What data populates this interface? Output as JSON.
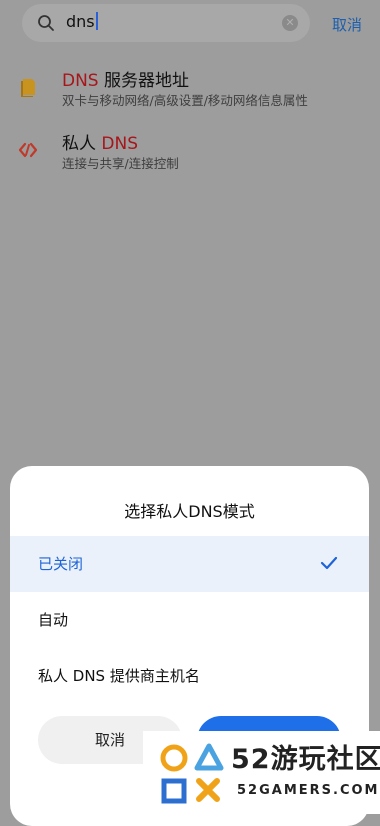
{
  "search": {
    "query": "dns",
    "cancel_label": "取消"
  },
  "results": [
    {
      "title_highlight": "DNS",
      "title_rest": " 服务器地址",
      "subtitle": "双卡与移动网络/高级设置/移动网络信息属性",
      "icon": "sim-card-icon",
      "icon_color": "#c8941f"
    },
    {
      "title_prefix": "私人 ",
      "title_highlight": "DNS",
      "subtitle": "连接与共享/连接控制",
      "icon": "connection-icon",
      "icon_color": "#c0392b"
    }
  ],
  "dialog": {
    "title": "选择私人DNS模式",
    "options": [
      {
        "label": "已关闭",
        "selected": true
      },
      {
        "label": "自动",
        "selected": false
      },
      {
        "label": "私人 DNS 提供商主机名",
        "selected": false
      }
    ],
    "cancel_label": "取消",
    "accent": "#1e6fe8"
  },
  "watermark": {
    "brand": "52游玩社区",
    "url": "52GAMERS.COM"
  }
}
